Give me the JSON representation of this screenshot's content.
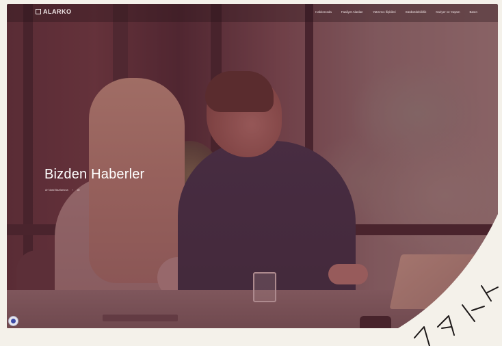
{
  "header": {
    "logo_text": "ALARKO",
    "nav": [
      "Hakkımızda",
      "Faaliyet Alanları",
      "Yatırımcı İlişkileri",
      "Sürdürülebilirlik",
      "Kariyer ve Yaşam",
      "Basın"
    ]
  },
  "hero": {
    "title": "Bizden Haberler",
    "breadcrumb": [
      "Ar Nasıl Bazılarsına",
      "Ar"
    ]
  },
  "decor": {
    "letters": [
      "K",
      "A",
      "A"
    ]
  },
  "colors": {
    "overlay": "#703040",
    "cream": "#f4f1ea"
  }
}
